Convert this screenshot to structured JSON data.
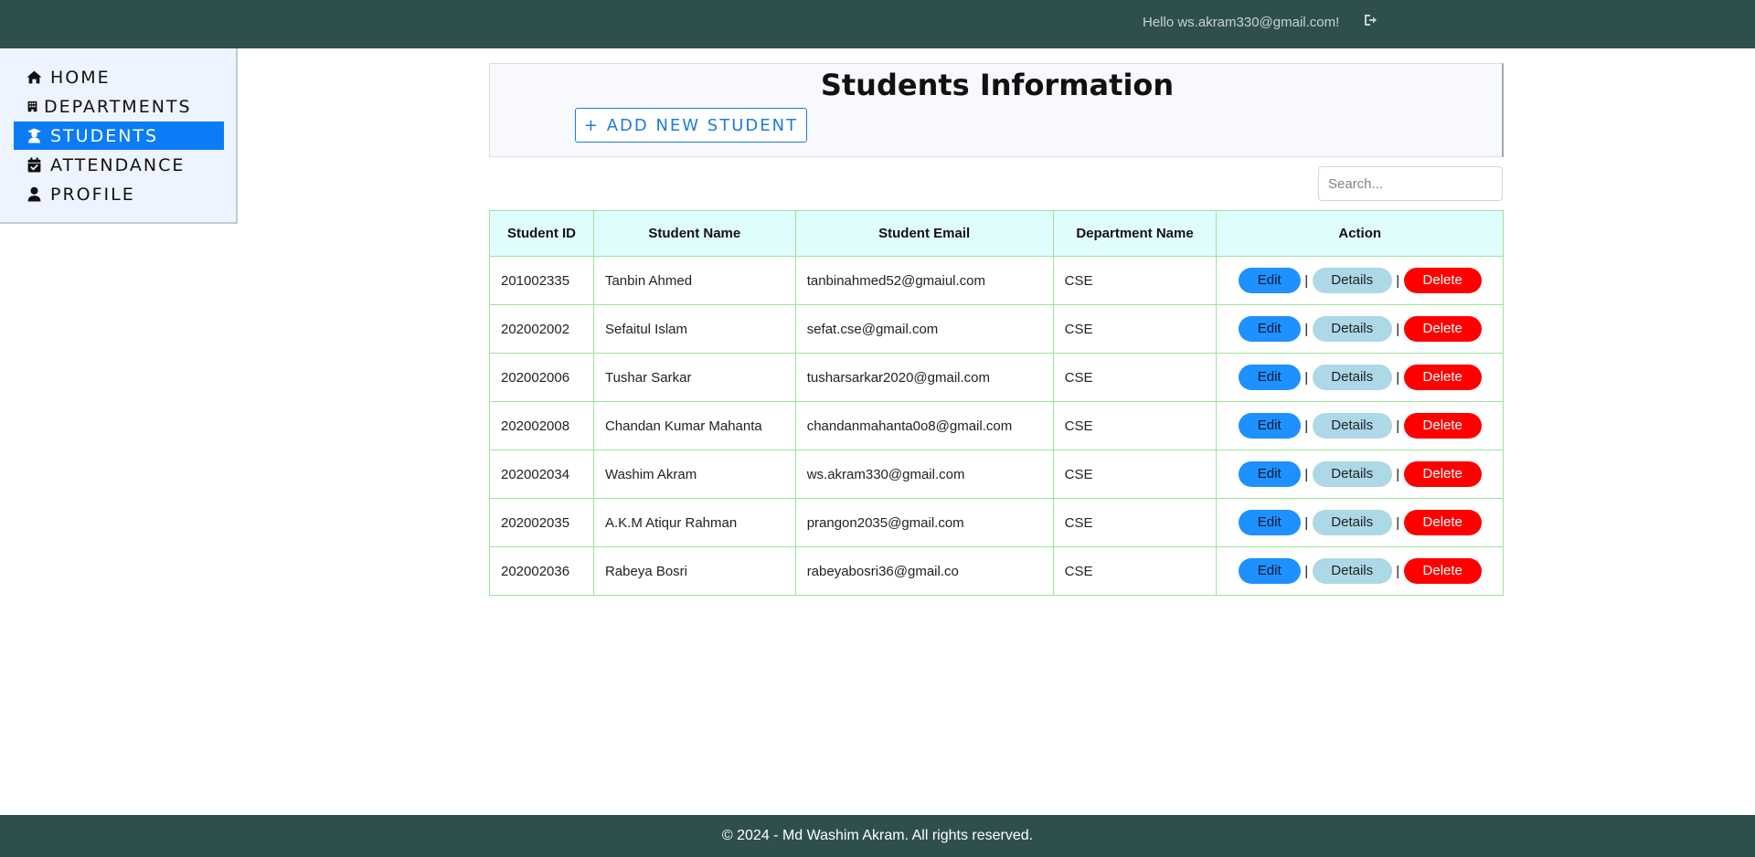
{
  "topbar": {
    "greeting": "Hello ws.akram330@gmail.com!",
    "logout_icon": "logout-icon"
  },
  "sidebar": {
    "items": [
      {
        "label": "HOME",
        "icon": "home-icon"
      },
      {
        "label": "DEPARTMENTS",
        "icon": "building-icon"
      },
      {
        "label": "STUDENTS",
        "icon": "student-icon",
        "active": true
      },
      {
        "label": "ATTENDANCE",
        "icon": "calendar-check-icon"
      },
      {
        "label": "PROFILE",
        "icon": "user-icon"
      }
    ],
    "active_color": "#0b7cf6"
  },
  "main": {
    "title": "Students Information",
    "add_button_label": "+ ADD NEW STUDENT",
    "search": {
      "placeholder": "Search...",
      "value": ""
    },
    "table": {
      "columns": [
        "Student ID",
        "Student Name",
        "Student Email",
        "Department Name",
        "Action"
      ],
      "rows": [
        {
          "id": "201002335",
          "name": "Tanbin Ahmed",
          "email": "tanbinahmed52@gmaiul.com",
          "dept": "CSE"
        },
        {
          "id": "202002002",
          "name": "Sefaitul Islam",
          "email": "sefat.cse@gmail.com",
          "dept": "CSE"
        },
        {
          "id": "202002006",
          "name": "Tushar Sarkar",
          "email": "tusharsarkar2020@gmail.com",
          "dept": "CSE"
        },
        {
          "id": "202002008",
          "name": "Chandan Kumar Mahanta",
          "email": "chandanmahanta0o8@gmail.com",
          "dept": "CSE"
        },
        {
          "id": "202002034",
          "name": "Washim Akram",
          "email": "ws.akram330@gmail.com",
          "dept": "CSE"
        },
        {
          "id": "202002035",
          "name": "A.K.M Atiqur Rahman",
          "email": "prangon2035@gmail.com",
          "dept": "CSE"
        },
        {
          "id": "202002036",
          "name": "Rabeya Bosri",
          "email": "rabeyabosri36@gmail.co",
          "dept": "CSE"
        }
      ],
      "actions": {
        "edit": "Edit",
        "details": "Details",
        "delete": "Delete",
        "separator": "|"
      }
    }
  },
  "footer": {
    "text": "© 2024 - Md Washim Akram. All rights reserved."
  },
  "colors": {
    "topbar": "#2f4f4f",
    "edit": "#1e90ff",
    "details": "#add8e6",
    "delete": "#ff0000",
    "table_header": "#e0fdfd",
    "table_border": "#9de39d"
  }
}
